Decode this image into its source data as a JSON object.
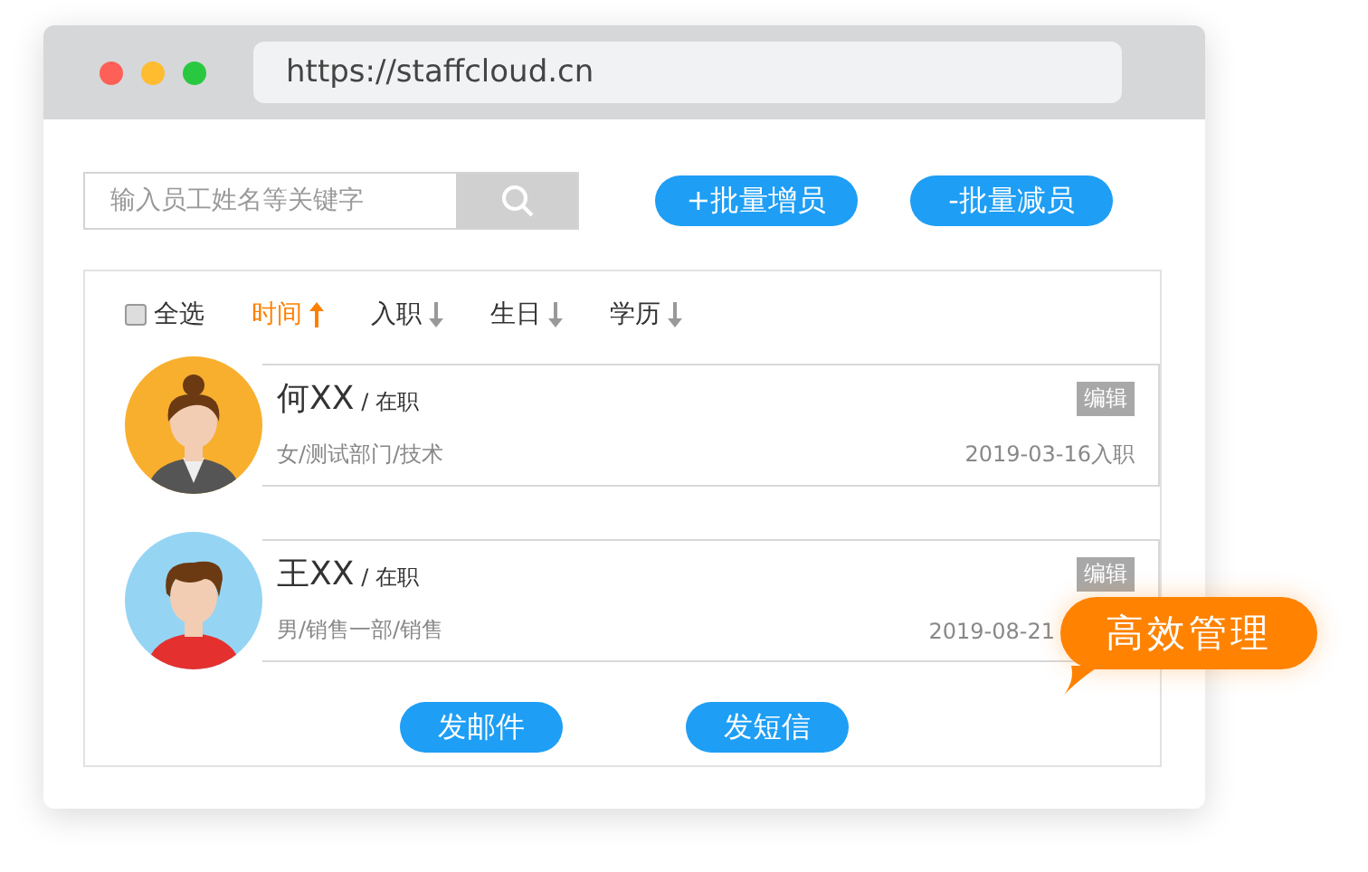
{
  "browser": {
    "url": "https://staffcloud.cn"
  },
  "search": {
    "placeholder": "输入员工姓名等关键字"
  },
  "actions": [
    {
      "label": "+批量增员"
    },
    {
      "label": "-批量减员"
    }
  ],
  "select_all": {
    "label": "全选",
    "checked": false
  },
  "sort": [
    {
      "label": "时间",
      "selected": true,
      "ascending": true
    },
    {
      "label": "入职",
      "selected": false,
      "ascending": false
    },
    {
      "label": "生日",
      "selected": false,
      "ascending": false
    },
    {
      "label": "学历",
      "selected": false,
      "ascending": false
    }
  ],
  "employees": [
    {
      "name": "何XX",
      "status": "/ 在职",
      "details": "女/测试部门/技术",
      "date": "2019-03-16入职",
      "edit": "编辑",
      "kind": "female"
    },
    {
      "name": "王XX",
      "status": "/ 在职",
      "details": "男/销售一部/销售",
      "date": "2019-08-21",
      "edit": "编辑",
      "kind": "male"
    }
  ],
  "bottom_actions": [
    {
      "label": "发邮件"
    },
    {
      "label": "发短信"
    }
  ],
  "callout": {
    "text": "高效管理"
  }
}
